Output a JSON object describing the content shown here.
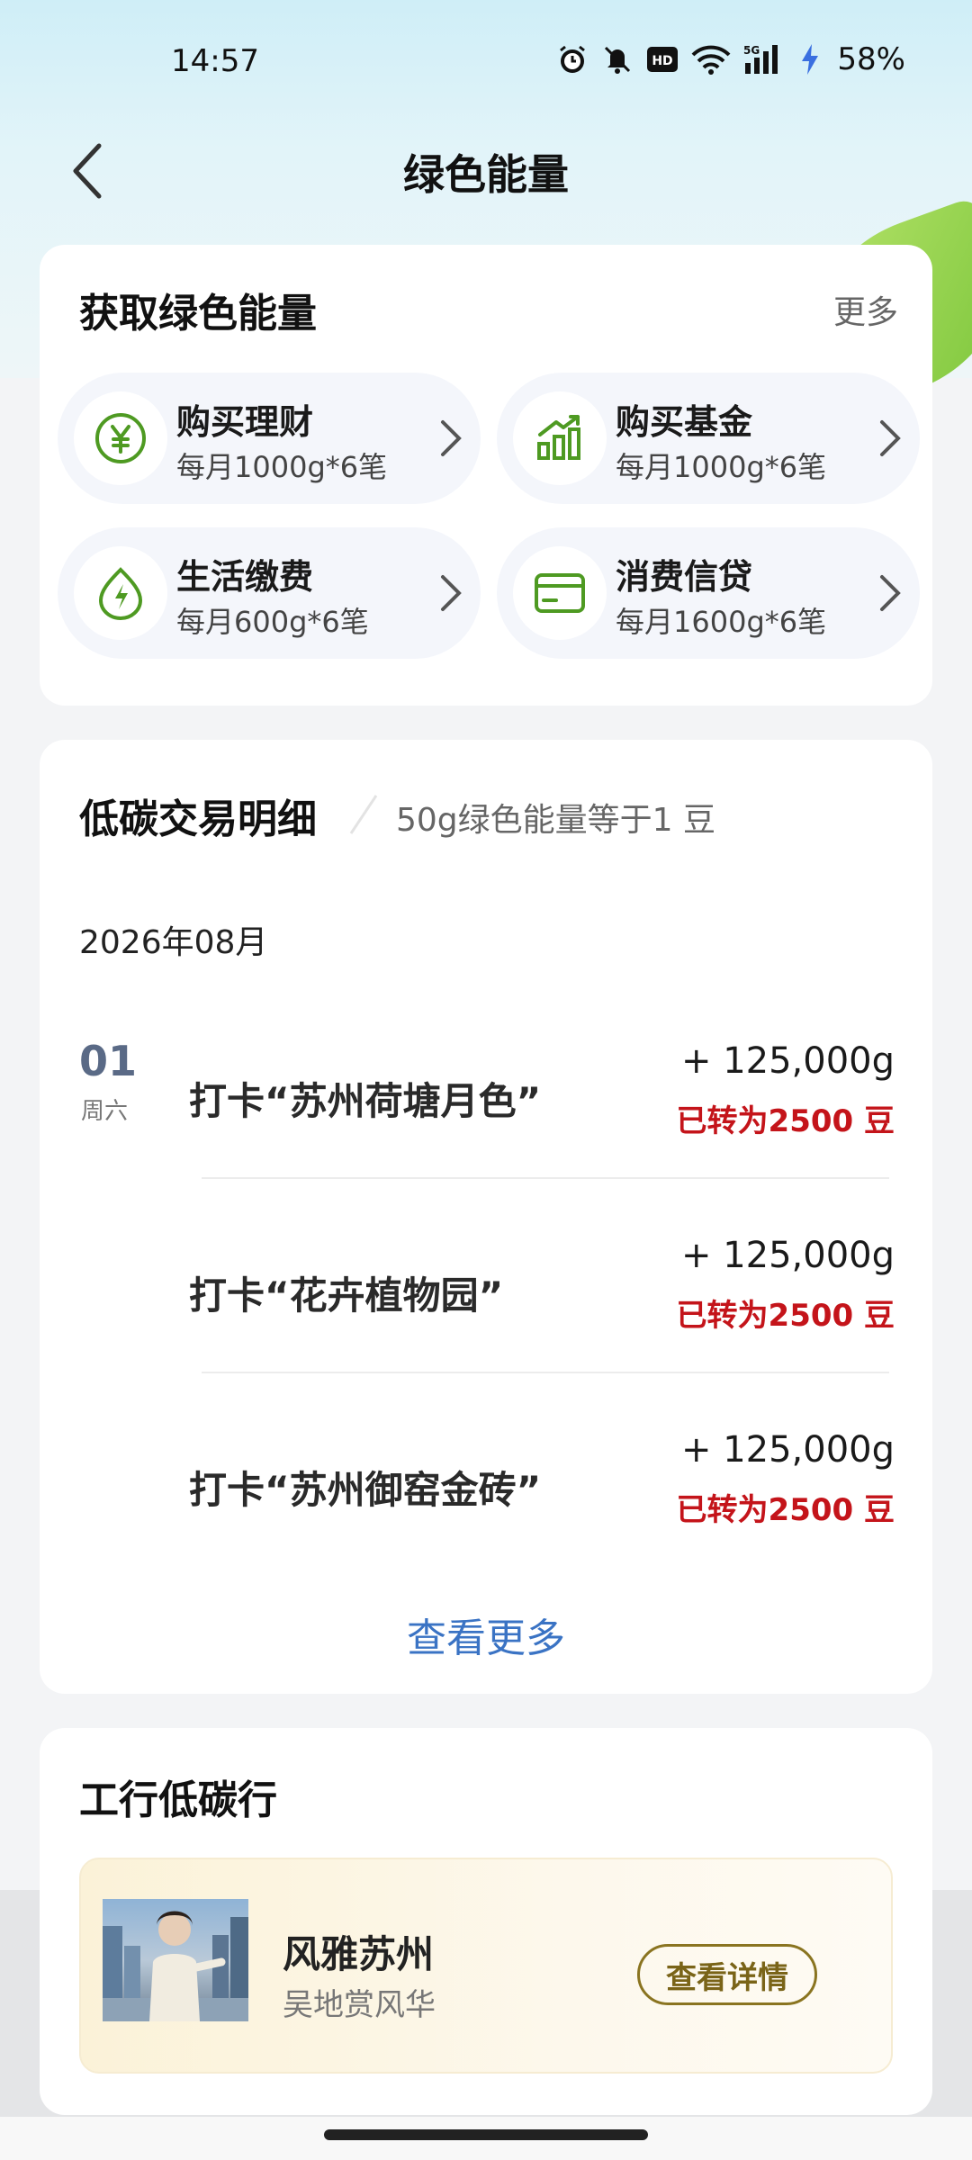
{
  "status_bar": {
    "time": "14:57",
    "battery": "58%",
    "icons": [
      "alarm-icon",
      "mute-icon",
      "hd-icon",
      "wifi-icon",
      "5g-signal-icon",
      "charging-icon"
    ],
    "hd_label": "HD",
    "network_label": "5G"
  },
  "nav": {
    "title": "绿色能量",
    "back_icon": "chevron-left-icon"
  },
  "earn": {
    "title": "获取绿色能量",
    "more": "更多",
    "items": [
      {
        "title": "购买理财",
        "sub": "每月1000g*6笔",
        "icon": "yen-coin-icon"
      },
      {
        "title": "购买基金",
        "sub": "每月1000g*6笔",
        "icon": "bar-chart-trend-icon"
      },
      {
        "title": "生活缴费",
        "sub": "每月600g*6笔",
        "icon": "leaf-lightning-icon"
      },
      {
        "title": "消费信贷",
        "sub": "每月1600g*6笔",
        "icon": "credit-card-icon"
      }
    ],
    "accent_color": "#4e9a22"
  },
  "transactions": {
    "title": "低碳交易明细",
    "rate_note": "50g绿色能量等于1 豆",
    "month": "2026年08月",
    "day": "01",
    "weekday": "周六",
    "items": [
      {
        "name": "打卡“苏州荷塘月色”",
        "amount": "+ 125,000g",
        "status": "已转为2500 豆"
      },
      {
        "name": "打卡“花卉植物园”",
        "amount": "+ 125,000g",
        "status": "已转为2500 豆"
      },
      {
        "name": "打卡“苏州御窑金砖”",
        "amount": "+ 125,000g",
        "status": "已转为2500 豆"
      }
    ],
    "view_more": "查看更多",
    "status_color": "#c4141a",
    "link_color": "#3a73c4"
  },
  "low_carbon": {
    "title": "工行低碳行",
    "promo": {
      "title": "风雅苏州",
      "sub": "吴地赏风华",
      "button": "查看详情"
    }
  }
}
